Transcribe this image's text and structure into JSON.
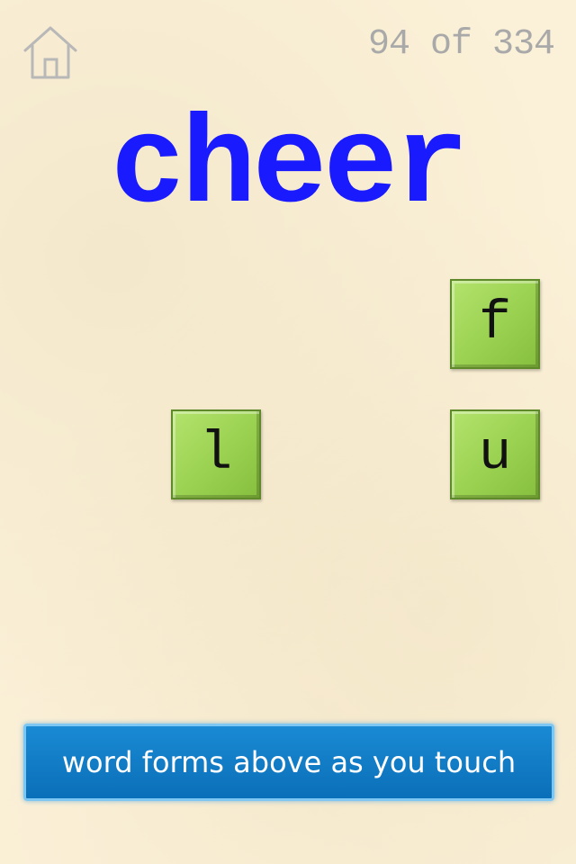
{
  "header": {
    "home_icon": "house-icon",
    "counter_text": "94 of 334"
  },
  "word": {
    "text": "cheer",
    "color": "#1a1aff"
  },
  "tiles": [
    {
      "letter": "f"
    },
    {
      "letter": "l"
    },
    {
      "letter": "u"
    }
  ],
  "hint": {
    "text": "word forms above as you touch"
  },
  "colors": {
    "tile_green": "#9ad150",
    "hint_blue": "#0a6fb8",
    "background": "#fbf1d8",
    "counter_gray": "#a9a9a9"
  }
}
